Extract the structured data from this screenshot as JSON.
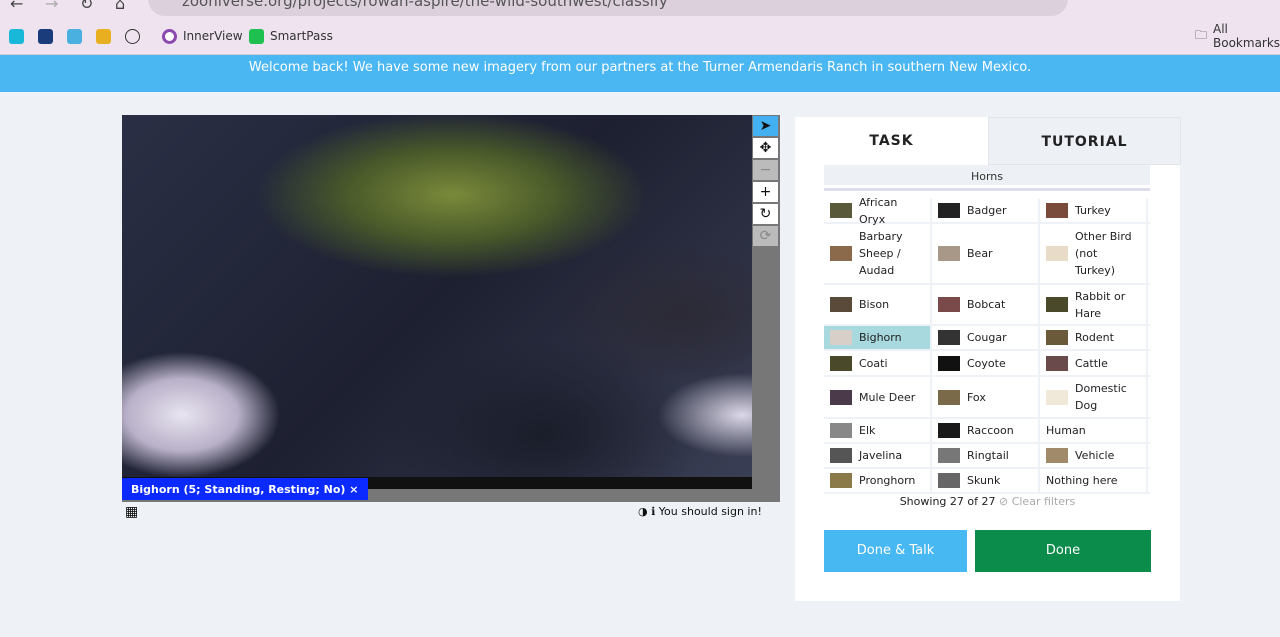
{
  "browser": {
    "url": "zooniverse.org/projects/rowan-aspire/the-wild-southwest/classify",
    "bookmarks": [
      "InnerView",
      "SmartPass"
    ],
    "all_bookmarks": "All Bookmarks"
  },
  "banner": "Welcome back! We have some new imagery from our partners at the Turner Armendaris Ranch in southern New Mexico.",
  "viewer": {
    "annotation_label": "Bighorn (5; Standing, Resting; No)",
    "annotation_close": "×",
    "signin": "You should sign in!"
  },
  "panel": {
    "tabs": [
      "TASK",
      "TUTORIAL"
    ],
    "filter": "Horns",
    "choices": [
      [
        {
          "label": "African Oryx",
          "c": "#5a5a3a"
        },
        {
          "label": "Badger",
          "c": "#222"
        },
        {
          "label": "Turkey",
          "c": "#7a4a3a"
        }
      ],
      [
        {
          "label": "Barbary Sheep / Audad",
          "c": "#8a6a4a"
        },
        {
          "label": "Bear",
          "c": "#a89888"
        },
        {
          "label": "Other Bird (not Turkey)",
          "c": "#e8dcc8"
        }
      ],
      [
        {
          "label": "Bison",
          "c": "#5a4a3a"
        },
        {
          "label": "Bobcat",
          "c": "#7a4a4a"
        },
        {
          "label": "Rabbit or Hare",
          "c": "#4a4a2a"
        }
      ],
      [
        {
          "label": "Bighorn",
          "c": "#d8d0c8",
          "sel": true
        },
        {
          "label": "Cougar",
          "c": "#333"
        },
        {
          "label": "Rodent",
          "c": "#6a5a3a"
        }
      ],
      [
        {
          "label": "Coati",
          "c": "#4a4a2a"
        },
        {
          "label": "Coyote",
          "c": "#111"
        },
        {
          "label": "Cattle",
          "c": "#6a4a4a"
        }
      ],
      [
        {
          "label": "Mule Deer",
          "c": "#4a3a4a"
        },
        {
          "label": "Fox",
          "c": "#7a6a4a"
        },
        {
          "label": "Domestic Dog",
          "c": "#f0e8d8"
        }
      ],
      [
        {
          "label": "Elk",
          "c": "#888"
        },
        {
          "label": "Raccoon",
          "c": "#1a1a1a"
        },
        {
          "label": "Human",
          "c": ""
        }
      ],
      [
        {
          "label": "Javelina",
          "c": "#555"
        },
        {
          "label": "Ringtail",
          "c": "#777"
        },
        {
          "label": "Vehicle",
          "c": "#a08a6a"
        }
      ],
      [
        {
          "label": "Pronghorn",
          "c": "#8a7a4a"
        },
        {
          "label": "Skunk",
          "c": "#666"
        },
        {
          "label": "Nothing here",
          "c": ""
        }
      ]
    ],
    "showing": "Showing 27 of 27",
    "clear": "⊘ Clear filters",
    "done_talk": "Done & Talk",
    "done": "Done"
  }
}
